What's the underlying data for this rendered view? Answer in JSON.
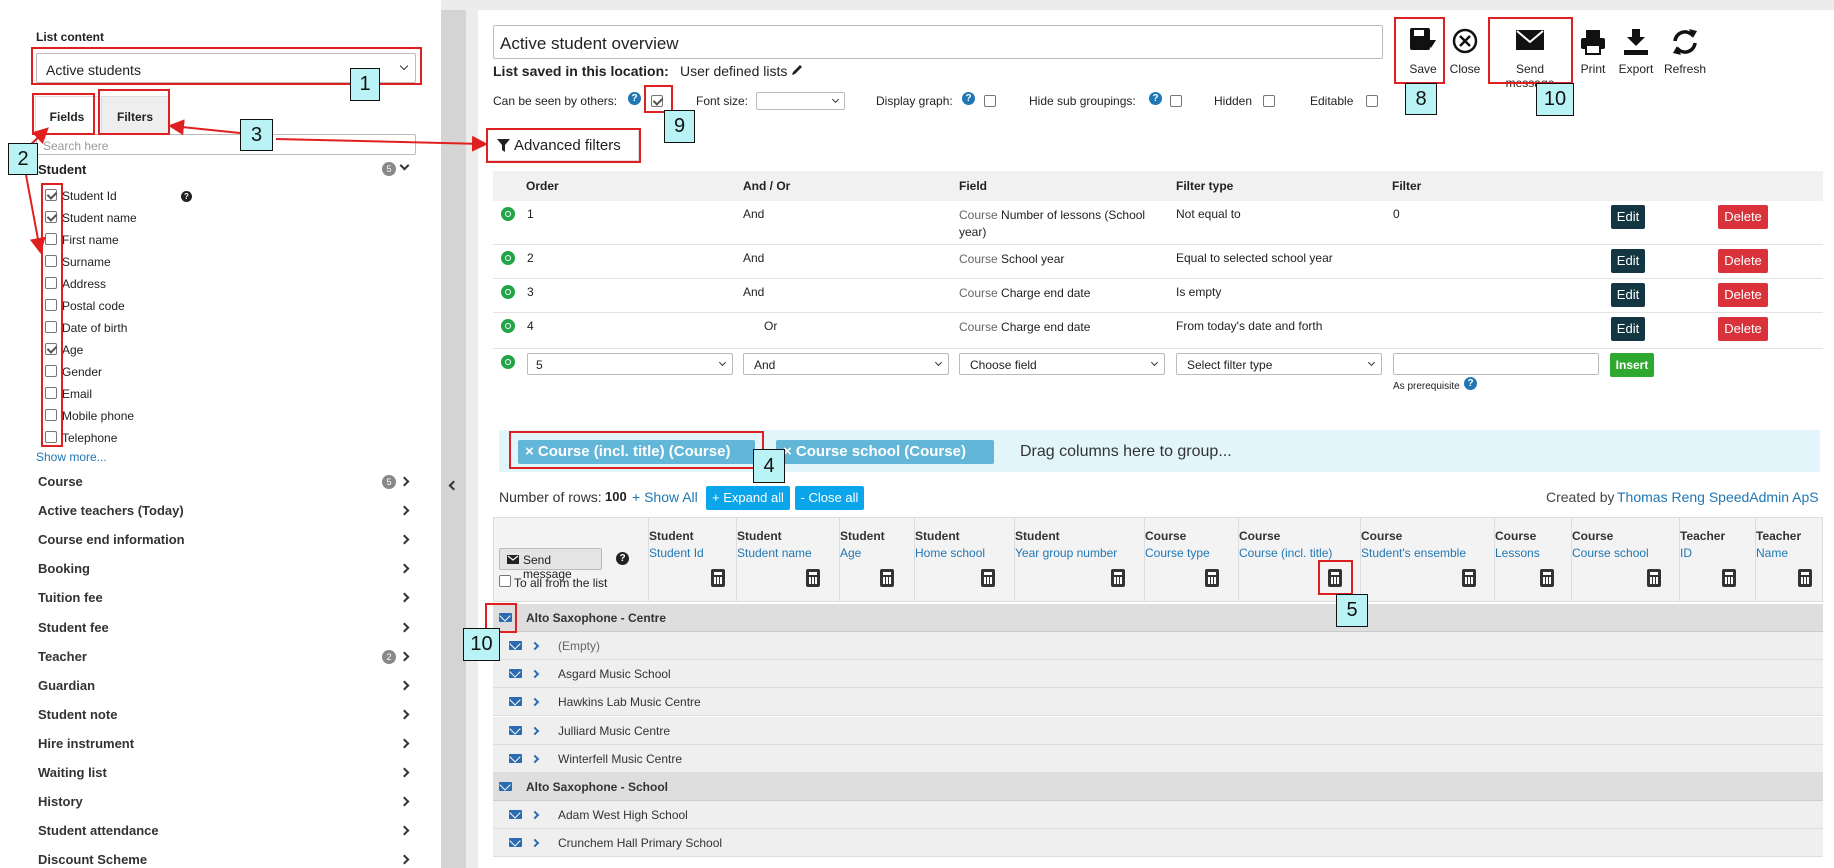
{
  "left": {
    "list_content_label": "List content",
    "list_content_value": "Active students",
    "tabs": [
      "Fields",
      "Filters"
    ],
    "search_placeholder": "Search here",
    "student_section": "Student",
    "student_badge": "5",
    "fields": [
      {
        "label": "Student Id",
        "checked": true
      },
      {
        "label": "Student name",
        "checked": true
      },
      {
        "label": "First name",
        "checked": false
      },
      {
        "label": "Surname",
        "checked": false
      },
      {
        "label": "Address",
        "checked": false
      },
      {
        "label": "Postal code",
        "checked": false
      },
      {
        "label": "Date of birth",
        "checked": false
      },
      {
        "label": "Age",
        "checked": true
      },
      {
        "label": "Gender",
        "checked": false
      },
      {
        "label": "Email",
        "checked": false
      },
      {
        "label": "Mobile phone",
        "checked": false
      },
      {
        "label": "Telephone",
        "checked": false
      }
    ],
    "show_more": "Show more...",
    "categories": [
      {
        "label": "Course",
        "badge": "5"
      },
      {
        "label": "Active teachers (Today)",
        "badge": ""
      },
      {
        "label": "Course end information",
        "badge": ""
      },
      {
        "label": "Booking",
        "badge": ""
      },
      {
        "label": "Tuition fee",
        "badge": ""
      },
      {
        "label": "Student fee",
        "badge": ""
      },
      {
        "label": "Teacher",
        "badge": "2"
      },
      {
        "label": "Guardian",
        "badge": ""
      },
      {
        "label": "Student note",
        "badge": ""
      },
      {
        "label": "Hire instrument",
        "badge": ""
      },
      {
        "label": "Waiting list",
        "badge": ""
      },
      {
        "label": "History",
        "badge": ""
      },
      {
        "label": "Student attendance",
        "badge": ""
      },
      {
        "label": "Discount Scheme",
        "badge": ""
      }
    ]
  },
  "main": {
    "title_value": "Active student overview",
    "saved_location_label": "List saved in this location:",
    "saved_location_value": "User defined lists",
    "options": {
      "can_be_seen": "Can be seen by others:",
      "font_size": "Font size:",
      "display_graph": "Display graph:",
      "hide_sub": "Hide sub groupings:",
      "hidden": "Hidden",
      "editable": "Editable"
    },
    "toolbar": {
      "save": "Save",
      "close": "Close",
      "send_message": "Send message",
      "print": "Print",
      "export": "Export",
      "refresh": "Refresh"
    },
    "advanced_filters": "Advanced filters",
    "filter_headers": [
      "Order",
      "And / Or",
      "Field",
      "Filter type",
      "Filter"
    ],
    "filters": [
      {
        "order": "1",
        "andor": "And",
        "prefix": "Course",
        "field": "Number of lessons (School year)",
        "type": "Not equal to",
        "filter": "0"
      },
      {
        "order": "2",
        "andor": "And",
        "prefix": "Course",
        "field": "School year",
        "type": "Equal to selected school year",
        "filter": ""
      },
      {
        "order": "3",
        "andor": "And",
        "prefix": "Course",
        "field": "Charge end date",
        "type": "Is empty",
        "filter": ""
      },
      {
        "order": "4",
        "andor": "Or",
        "prefix": "Course",
        "field": "Charge end date",
        "type": "From today's date and forth",
        "filter": ""
      }
    ],
    "edit_label": "Edit",
    "delete_label": "Delete",
    "new_filter": {
      "order": "5",
      "andor": "And",
      "field": "Choose field",
      "type": "Select filter type",
      "insert": "Insert",
      "prereq": "As prerequisite"
    },
    "group_chips": [
      "× Course (incl. title) (Course)",
      "× Course school (Course)"
    ],
    "drag_hint": "Drag columns here to group...",
    "rows_label": "Number of rows:",
    "rows_count": "100",
    "show_all": "+ Show All",
    "expand_all": "+ Expand all",
    "close_all": "- Close all",
    "created_by": "Created by",
    "created_by_name": "Thomas Reng SpeedAdmin ApS",
    "send_message_btn": "Send message",
    "to_all": "To all from the list",
    "columns": [
      {
        "top": "Student",
        "sub": "Student Id"
      },
      {
        "top": "Student",
        "sub": "Student name"
      },
      {
        "top": "Student",
        "sub": "Age"
      },
      {
        "top": "Student",
        "sub": "Home school"
      },
      {
        "top": "Student",
        "sub": "Year group number"
      },
      {
        "top": "Course",
        "sub": "Course type"
      },
      {
        "top": "Course",
        "sub": "Course (incl. title)"
      },
      {
        "top": "Course",
        "sub": "Student's ensemble"
      },
      {
        "top": "Course",
        "sub": "Lessons"
      },
      {
        "top": "Course",
        "sub": "Course school"
      },
      {
        "top": "Teacher",
        "sub": "ID"
      },
      {
        "top": "Teacher",
        "sub": "Name"
      }
    ],
    "groups": [
      {
        "title": "Alto Saxophone - Centre",
        "items": [
          "(Empty)",
          "Asgard Music School",
          "Hawkins Lab Music Centre",
          "Julliard Music Centre",
          "Winterfell Music Centre"
        ]
      },
      {
        "title": "Alto Saxophone - School",
        "items": [
          "Adam West High School",
          "Crunchem Hall Primary School"
        ]
      }
    ]
  },
  "annotations": [
    "1",
    "2",
    "3",
    "4",
    "5",
    "8",
    "9",
    "10",
    "10"
  ]
}
